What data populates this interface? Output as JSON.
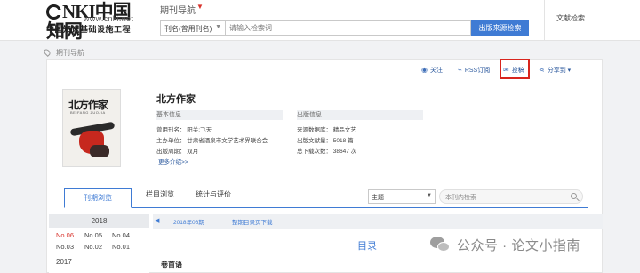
{
  "header": {
    "logo_main": "NKI中国知网",
    "logo_url": "www.cnki.net",
    "logo_sub": "中国知识基础设施工程",
    "nav_title": "期刊导航",
    "nav_caret": "▼",
    "search_field": "刊名(曾用刊名)",
    "search_placeholder": "请输入检索词",
    "search_button": "出版来源检索",
    "doc_search": "文献检索"
  },
  "breadcrumb": "期刊导航",
  "actions": {
    "follow": "关注",
    "rss": "RSS订阅",
    "contribute": "投稿",
    "share": "分享到"
  },
  "cover": {
    "title": "北方作家",
    "subtitle": "BEIFANG ZUOJIA"
  },
  "journal": {
    "title": "北方作家",
    "basic_header": "基本信息",
    "pub_header": "出版信息",
    "former_name": "曾用刊名：  阳关;飞天",
    "sponsor": "主办单位：  甘肃省酒泉市文学艺术界联合会",
    "cycle": "出版周期：  双月",
    "source_db": "来源数据库：  精品文艺",
    "pub_count": "出版文献量：  5018 篇",
    "download_count": "总下载次数：  38647 次",
    "more": "更多介绍>>"
  },
  "tabs": [
    "刊期浏览",
    "栏目浏览",
    "统计与评价"
  ],
  "filter": {
    "topic": "主题",
    "inner_placeholder": "本刊内检索"
  },
  "sidebar": {
    "year": "2018",
    "issues": [
      "No.06",
      "No.05",
      "No.04",
      "No.03",
      "No.02",
      "No.01"
    ],
    "next_year": "2017"
  },
  "content": {
    "current_issue": "2018年06期",
    "issue_download": "整期目录页下载",
    "toc_title": "目录",
    "first_section": "卷首语"
  },
  "watermark": "公众号 · 论文小指南"
}
